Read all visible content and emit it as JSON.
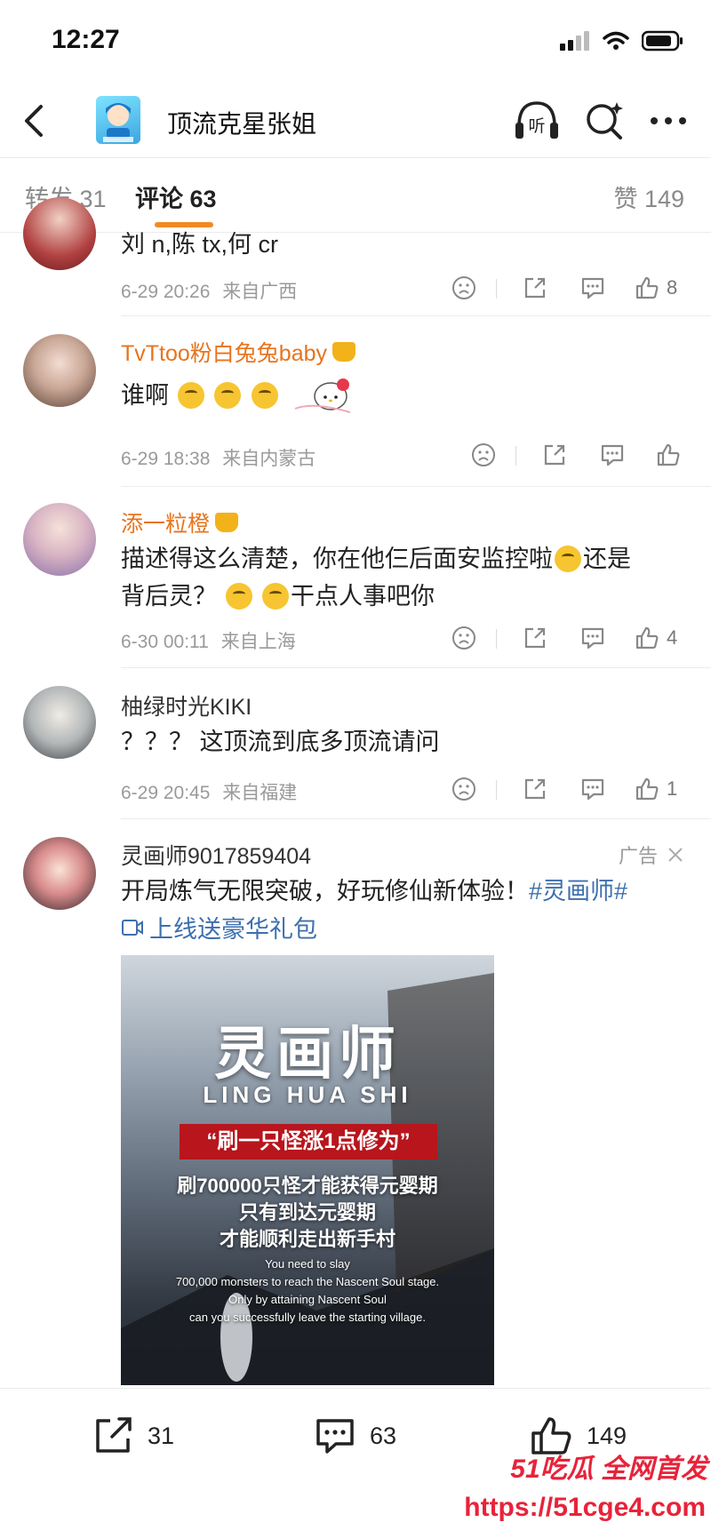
{
  "status_bar": {
    "time": "12:27",
    "icons": [
      "signal-icon",
      "wifi-icon",
      "battery-icon"
    ]
  },
  "nav": {
    "title": "顶流克星张姐",
    "listen_label": "听",
    "icons": [
      "back-icon",
      "listen-icon",
      "search-icon",
      "more-icon"
    ]
  },
  "tabs": {
    "repost": "转发 31",
    "comments": "评论 63",
    "likes": "赞 149",
    "accent": "#f08a24"
  },
  "comments": [
    {
      "name": "",
      "text": "刘 n,陈 tx,何 cr",
      "time": "6-29 20:26",
      "location": "来自广西",
      "likes": "8"
    },
    {
      "name": "TvTtoo粉白兔兔baby",
      "text": "谁啊",
      "time": "6-29 18:38",
      "location": "来自内蒙古",
      "likes": "",
      "name_color": "#e8731c"
    },
    {
      "name": "添一粒橙",
      "text_line1": "描述得这么清楚，你在他仨后面安监控啦",
      "text_line1_end": "还是",
      "text_line2_start": "背后灵？",
      "text_line2_end": "干点人事吧你",
      "time": "6-30 00:11",
      "location": "来自上海",
      "likes": "4",
      "name_color": "#e8731c"
    },
    {
      "name": "柚绿时光KIKI",
      "text": "？？？ 这顶流到底多顶流请问",
      "time": "6-29 20:45",
      "location": "来自福建",
      "likes": "1"
    }
  ],
  "ad": {
    "name": "灵画师9017859404",
    "tag": "广告",
    "text": "开局炼气无限突破，好玩修仙新体验！",
    "hashtag": "#灵画师#",
    "link": "上线送豪华礼包",
    "image": {
      "title": "灵画师",
      "subtitle": "LING HUA SHI",
      "banner": "“刷一只怪涨1点修为”",
      "line1": "刷700000只怪才能获得元婴期",
      "line2": "只有到达元婴期",
      "line3": "才能顺利走出新手村",
      "en1": "You need to slay",
      "en2": "700,000 monsters to reach the Nascent Soul stage.",
      "en3": "Only by attaining Nascent Soul",
      "en4": "can you successfully leave the starting village."
    }
  },
  "bottom_bar": {
    "repost_count": "31",
    "comment_count": "63",
    "like_count": "149"
  },
  "watermark": {
    "top": "51吃瓜 全网首发",
    "url": "https://51cge4.com"
  }
}
